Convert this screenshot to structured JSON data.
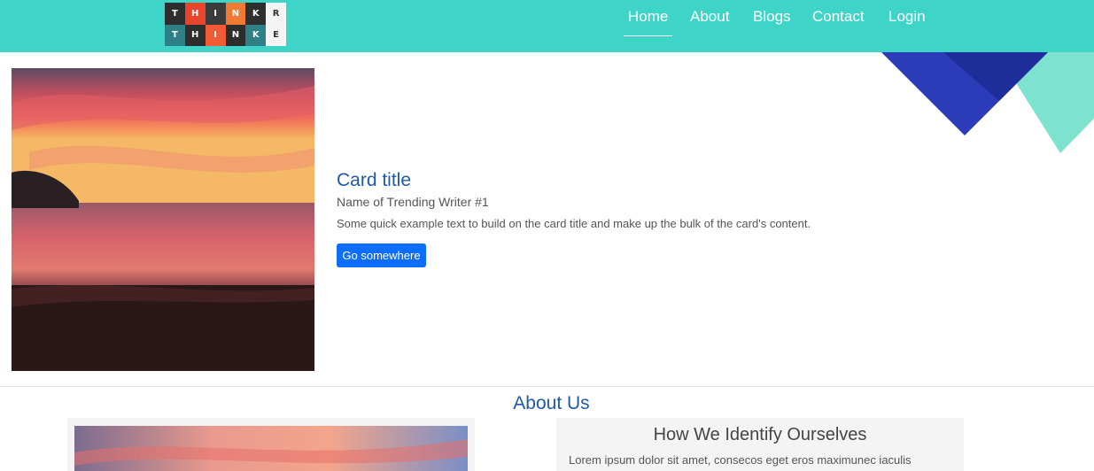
{
  "navbar": {
    "background": "#3fd4c8",
    "logo": {
      "rows": [
        [
          {
            "char": "T",
            "color": "#2d2d2d"
          },
          {
            "char": "H",
            "color": "#e8452c"
          },
          {
            "char": "I",
            "color": "#3b3b3b"
          },
          {
            "char": "N",
            "color": "#f07a34"
          },
          {
            "char": "K",
            "color": "#2f2f2f"
          },
          {
            "char": "R",
            "color": "#f4f4f4",
            "text_color": "#333333"
          }
        ],
        [
          {
            "char": "T",
            "color": "#2e7f86"
          },
          {
            "char": "H",
            "color": "#2e2e2e"
          },
          {
            "char": "I",
            "color": "#f05a34"
          },
          {
            "char": "N",
            "color": "#2d2d2d"
          },
          {
            "char": "K",
            "color": "#2e7f86"
          },
          {
            "char": "E",
            "color": "#f4f4f4",
            "text_color": "#333333"
          }
        ]
      ]
    },
    "links": [
      {
        "label": "Home",
        "active": true
      },
      {
        "label": "About"
      },
      {
        "label": "Blogs"
      },
      {
        "label": "Contact"
      },
      {
        "label": "Login"
      }
    ]
  },
  "decor_colors": {
    "dark_blue": "#2c3cb8",
    "navy": "#1f2d9a",
    "mint": "#7de3cf"
  },
  "card": {
    "image_icon": "sunset-beach-image",
    "title": "Card title",
    "subtitle": "Name of Trending Writer #1",
    "text": "Some quick example text to build on the card title and make up the bulk of the card's content.",
    "button_label": "Go somewhere",
    "button_color": "#0d6efd"
  },
  "about": {
    "title": "About Us",
    "image_icon": "sunset-sky-image",
    "heading": "How We Identify Ourselves",
    "text": "Lorem ipsum dolor sit amet, consecos eget eros maximunec iaculis"
  }
}
